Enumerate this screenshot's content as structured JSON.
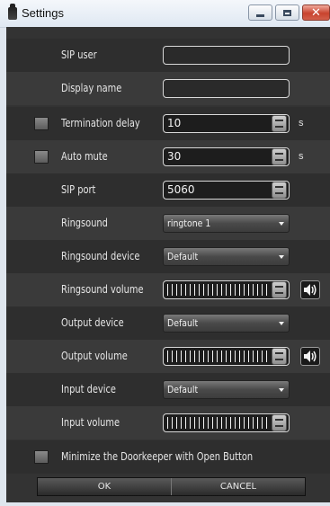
{
  "window": {
    "title": "Settings",
    "controls": [
      "minimize-icon",
      "maximize-icon",
      "close-icon"
    ],
    "close_color": "#c8432e"
  },
  "settings": {
    "sip_user": {
      "label": "SIP user",
      "value": ""
    },
    "display_name": {
      "label": "Display name",
      "value": ""
    },
    "termination_delay": {
      "label": "Termination delay",
      "value": "10",
      "unit": "s",
      "checked": false
    },
    "auto_mute": {
      "label": "Auto mute",
      "value": "30",
      "unit": "s",
      "checked": false
    },
    "sip_port": {
      "label": "SIP port",
      "value": "5060"
    },
    "ringsound": {
      "label": "Ringsound",
      "value": "ringtone 1"
    },
    "ringsound_device": {
      "label": "Ringsound device",
      "value": "Default"
    },
    "ringsound_volume": {
      "label": "Ringsound volume",
      "level": 1.0
    },
    "output_device": {
      "label": "Output device",
      "value": "Default"
    },
    "output_volume": {
      "label": "Output volume",
      "level": 1.0
    },
    "input_device": {
      "label": "Input device",
      "value": "Default"
    },
    "input_volume": {
      "label": "Input volume",
      "level": 1.0
    },
    "minimize_option": {
      "label": "Minimize the Doorkeeper with Open Button",
      "checked": false
    }
  },
  "footer": {
    "ok_label": "OK",
    "cancel_label": "CANCEL"
  },
  "colors": {
    "panel": "#333333",
    "row_dark": "#2e2e2e",
    "row_light": "#3a3a3a",
    "text": "#e6e6e6"
  }
}
